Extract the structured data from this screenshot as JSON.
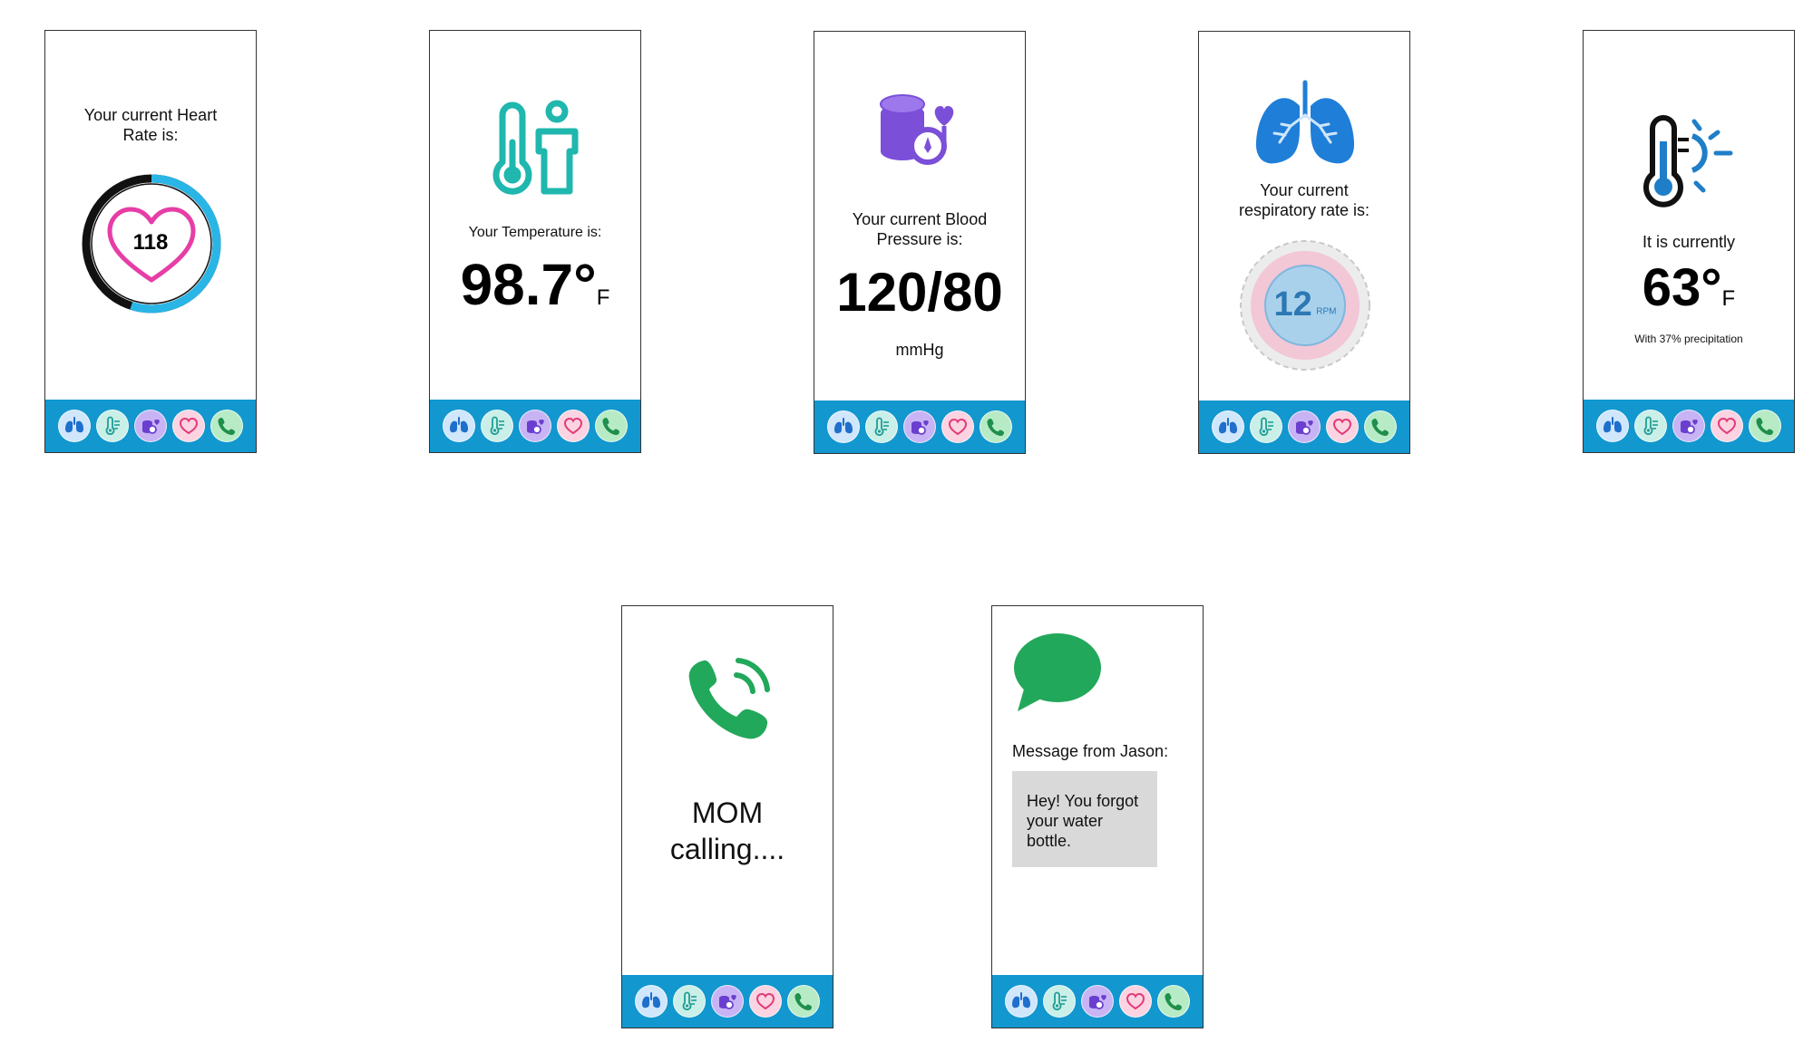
{
  "nav": [
    {
      "icon": "lungs-icon"
    },
    {
      "icon": "thermometer-icon"
    },
    {
      "icon": "blood-pressure-icon"
    },
    {
      "icon": "heart-icon"
    },
    {
      "icon": "phone-icon"
    }
  ],
  "heart_rate": {
    "label": "Your current Heart Rate is:",
    "value": "118",
    "ring_fraction": 0.55,
    "ring_color": "#29b6e6",
    "heart_color": "#e63ea6"
  },
  "temperature": {
    "label": "Your Temperature is:",
    "value": "98.7°",
    "unit": "F",
    "icon_color": "#1fb7ae"
  },
  "blood_pressure": {
    "label": "Your current Blood Pressure is:",
    "value": "120/80",
    "unit": "mmHg",
    "icon_color": "#7b4fd8"
  },
  "respiratory": {
    "label": "Your current respiratory rate is:",
    "value": "12",
    "unit": "RPM",
    "icon_color": "#1f7ed8"
  },
  "weather": {
    "label": "It is currently",
    "value": "63°",
    "unit": "F",
    "note": "With 37% precipitation",
    "icon_color": "#1f7ec8"
  },
  "call": {
    "caller": "MOM",
    "status": "calling....",
    "icon_color": "#22a85a"
  },
  "message": {
    "label": "Message from Jason:",
    "body": "Hey! You forgot your water bottle.",
    "icon_color": "#22a85a"
  }
}
